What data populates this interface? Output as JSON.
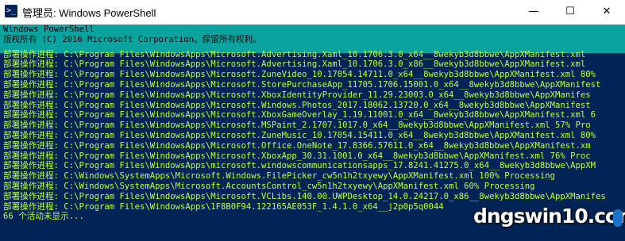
{
  "window": {
    "title": "管理员: Windows PowerShell",
    "icon_glyph": ">_",
    "controls": {
      "minimize": "—",
      "maximize": "☐",
      "close": "✕"
    }
  },
  "console": {
    "header_lines": [
      "Windows PowerShell",
      "版权所有 (C) 2016 Microsoft Corporation。保留所有权利。"
    ],
    "progress_lines": [
      "部署操作进程: C:\\Program Files\\WindowsApps\\Microsoft.Advertising.Xaml_10.1706.3.0_x64__8wekyb3d8bbwe\\AppXManifest.xml",
      "部署操作进程: C:\\Program Files\\WindowsApps\\Microsoft.Advertising.Xaml_10.1706.3.0_x86__8wekyb3d8bbwe\\AppXManifest.xml",
      "部署操作进程: C:\\Program Files\\WindowsApps\\Microsoft.ZuneVideo_10.17054.14711.0_x64__8wekyb3d8bbwe\\AppXManifest.xml 80%",
      "部署操作进程: C:\\Program Files\\WindowsApps\\Microsoft.StorePurchaseApp_11705.1706.15001.0_x64__8wekyb3d8bbwe\\AppXManifest",
      "部署操作进程: C:\\Program Files\\WindowsApps\\Microsoft.XboxIdentityProvider_11.29.23003.0_x64__8wekyb3d8bbwe\\AppXManifes",
      "部署操作进程: C:\\Program Files\\WindowsApps\\Microsoft.Windows.Photos_2017.18062.13720.0_x64__8wekyb3d8bbwe\\AppXManifest",
      "部署操作进程: C:\\Program Files\\WindowsApps\\Microsoft.XboxGameOverlay_1.19.11001.0_x64__8wekyb3d8bbwe\\AppXManifest.xml 6",
      "部署操作进程: C:\\Program Files\\WindowsApps\\Microsoft.MSPaint_2.1707.1017.0_x64__8wekyb3d8bbwe\\AppXManifest.xml 57% Pro",
      "部署操作进程: C:\\Program Files\\WindowsApps\\Microsoft.ZuneMusic_10.17054.15411.0_x64__8wekyb3d8bbwe\\AppXManifest.xml 80%",
      "部署操作进程: C:\\Program Files\\WindowsApps\\Microsoft.Office.OneNote_17.8366.57611.0_x64__8wekyb3d8bbwe\\AppXManifest.xm",
      "部署操作进程: C:\\Program Files\\WindowsApps\\Microsoft.XboxApp_30.31.1001.0_x64__8wekyb3d8bbwe\\AppXManifest.xml 76% Proc",
      "部署操作进程: C:\\Program Files\\WindowsApps\\microsoft.windowscommunicationsapps_17.8241.41275.0_x64__8wekyb3d8bbwe\\AppXM",
      "部署操作进程: C:\\Windows\\SystemApps\\Microsoft.Windows.FilePicker_cw5n1h2txyewy\\AppXManifest.xml 100% Processing",
      "部署操作进程: C:\\Windows\\SystemApps\\Microsoft.AccountsControl_cw5n1h2txyewy\\AppXManifest.xml 60% Processing",
      "部署操作进程: C:\\Program Files\\WindowsApps\\Microsoft.VCLibs.140.00.UWPDesktop_14.0.24217.0_x86__8wekyb3d8bbwe\\AppXManifes",
      "部署操作进程: C:\\Program Files\\WindowsApps\\1F8B0F94.122165AE053F_1.4.1.0_x64__j2p0p5q0044"
    ],
    "footer_line": "66 个活动未显示..."
  },
  "colors": {
    "console_background": "#012456",
    "progress_bar": "#0aa3a0",
    "progress_text": "#c2ff3a"
  },
  "watermark": {
    "text": "dngswin10.com"
  }
}
